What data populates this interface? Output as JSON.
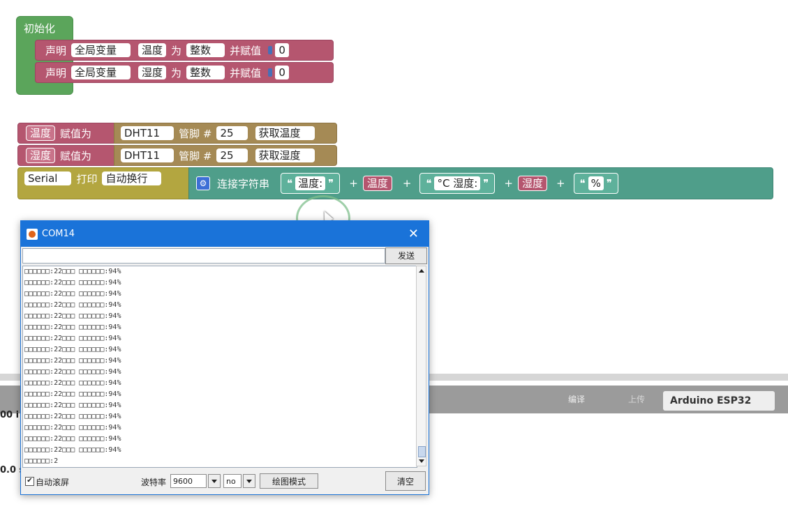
{
  "blocks": {
    "init_label": "初始化",
    "declare": {
      "label": "声明",
      "scope": "全局变量",
      "as": "为",
      "type": "整数",
      "assign": "并赋值",
      "rows": [
        {
          "var": "温度",
          "value": "0"
        },
        {
          "var": "湿度",
          "value": "0"
        }
      ]
    },
    "sensor_rows": [
      {
        "var": "温度",
        "assign": "赋值为",
        "sensor": "DHT11",
        "pin_label": "管脚 #",
        "pin": "25",
        "action": "获取温度"
      },
      {
        "var": "湿度",
        "assign": "赋值为",
        "sensor": "DHT11",
        "pin_label": "管脚 #",
        "pin": "25",
        "action": "获取湿度"
      }
    ],
    "serial": {
      "port": "Serial",
      "print": "打印",
      "mode": "自动换行",
      "concat": "连接字符串",
      "str1": "温度:",
      "var1": "温度",
      "str2": "°C 湿度:",
      "var2": "湿度",
      "str3": "%",
      "plus": "+",
      "quote_open": "❝",
      "quote_close": "❞"
    }
  },
  "ide": {
    "compile": "编译",
    "upload": "上传",
    "board": "Arduino ESP32",
    "side_text_1": "00 i",
    "side_text_2": "0.0 s"
  },
  "serial_monitor": {
    "title": "COM14",
    "send_button": "发送",
    "send_value": "",
    "lines": [
      "□□□□□□:22□□□ □□□□□□:94%",
      "□□□□□□:22□□□ □□□□□□:94%",
      "□□□□□□:22□□□ □□□□□□:94%",
      "□□□□□□:22□□□ □□□□□□:94%",
      "□□□□□□:22□□□ □□□□□□:94%",
      "□□□□□□:22□□□ □□□□□□:94%",
      "□□□□□□:22□□□ □□□□□□:94%",
      "□□□□□□:22□□□ □□□□□□:94%",
      "□□□□□□:22□□□ □□□□□□:94%",
      "□□□□□□:22□□□ □□□□□□:94%",
      "□□□□□□:22□□□ □□□□□□:94%",
      "□□□□□□:22□□□ □□□□□□:94%",
      "□□□□□□:22□□□ □□□□□□:94%",
      "□□□□□□:22□□□ □□□□□□:94%",
      "□□□□□□:22□□□ □□□□□□:94%",
      "□□□□□□:22□□□ □□□□□□:94%",
      "□□□□□□:22□□□ □□□□□□:94%",
      "□□□□□□:2"
    ],
    "autoscroll_label": "自动滚屏",
    "baud_label": "波特率",
    "baud_value": "9600",
    "line_ending": "no",
    "plot_button": "绘图模式",
    "clear_button": "清空"
  }
}
